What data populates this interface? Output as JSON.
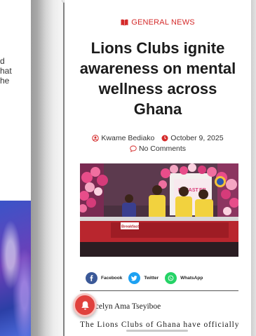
{
  "background_page": {
    "text_lines": [
      "d",
      "hat",
      "he"
    ]
  },
  "article": {
    "category": "GENERAL NEWS",
    "title": "Lions Clubs ignite awareness on mental wellness across Ghana",
    "author": "Kwame Bediako",
    "date": "October 9, 2025",
    "comments": "No Comments",
    "image_text": {
      "backdrop": "BREAST",
      "backdrop_2": "ER",
      "desk_logo": "Breakfast"
    },
    "byline": "ycelyn Ama Tseyiboe",
    "body_start": "The Lions Clubs of Ghana have officially"
  },
  "share": {
    "facebook": "Facebook",
    "twitter": "Twitter",
    "whatsapp": "WhatsApp"
  },
  "colors": {
    "accent_red": "#d42a2a",
    "facebook": "#3b5998",
    "twitter": "#1da1f2",
    "whatsapp": "#25d366",
    "bell": "#e0413d"
  },
  "icons": {
    "category": "book-icon",
    "author": "user-circle-icon",
    "date": "clock-icon",
    "comments": "comment-icon",
    "bell": "bell-icon"
  }
}
